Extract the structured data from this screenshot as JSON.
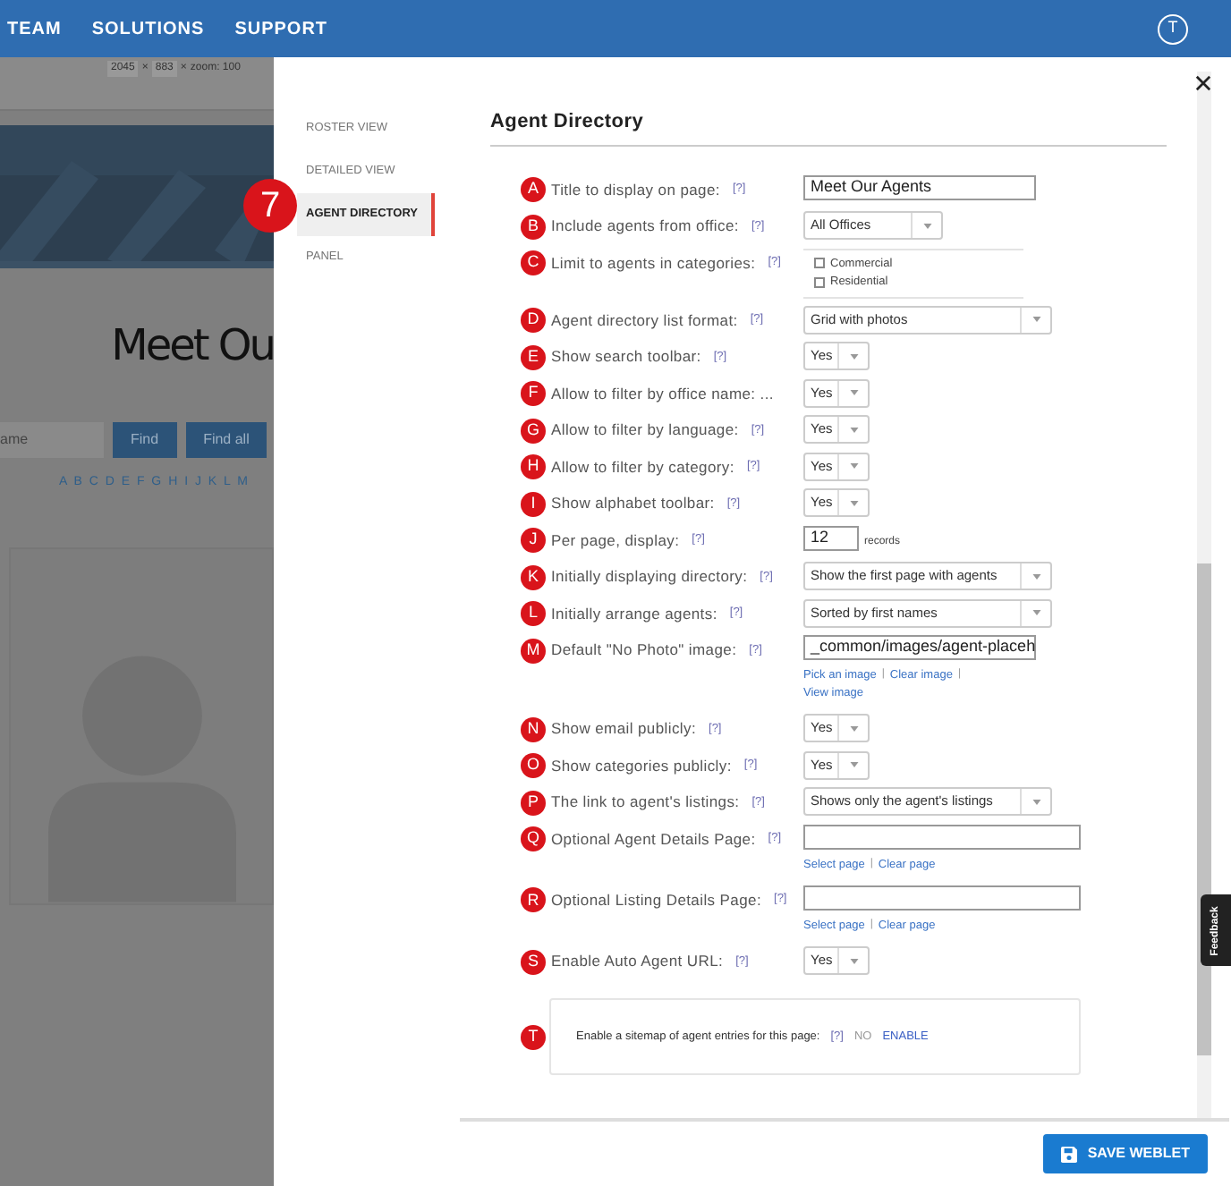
{
  "nav": {
    "items": [
      "TEAM",
      "SOLUTIONS",
      "SUPPORT"
    ],
    "avatar": "T"
  },
  "background": {
    "ruler": [
      "2045",
      "×",
      "883",
      "×",
      "zoom: 100"
    ],
    "heading": "Meet Ou",
    "search_placeholder": "ame",
    "buttons": [
      "Find",
      "Find all"
    ],
    "alphabet": "A B C D E F G H I J K L M"
  },
  "modal": {
    "tabs": [
      {
        "label": "ROSTER VIEW",
        "selected": false
      },
      {
        "label": "DETAILED VIEW",
        "selected": false
      },
      {
        "label": "AGENT DIRECTORY",
        "selected": true
      },
      {
        "label": "PANEL",
        "selected": false
      }
    ],
    "callout": "7",
    "heading": "Agent Directory",
    "separator": "|",
    "rows": [
      {
        "letter": "A",
        "label": "Title to display on page:",
        "help": "[?]",
        "control": {
          "kind": "text",
          "value": "Meet Our Agents"
        }
      },
      {
        "letter": "B",
        "label": "Include agents from office:",
        "help": "[?]",
        "control": {
          "kind": "smallselect",
          "value": "All Offices"
        }
      },
      {
        "letter": "C",
        "label": "Limit to agents in categories:",
        "help": "[?]",
        "control": {
          "kind": "checkboxes",
          "options": [
            {
              "label": "Commercial",
              "checked": false
            },
            {
              "label": "Residential",
              "checked": false
            }
          ]
        }
      },
      {
        "letter": "D",
        "label": "Agent directory list format:",
        "help": "[?]",
        "control": {
          "kind": "select",
          "value": "Grid with photos"
        }
      },
      {
        "letter": "E",
        "label": "Show search toolbar:",
        "help": "[?]",
        "control": {
          "kind": "yesno",
          "value": "Yes"
        }
      },
      {
        "letter": "F",
        "label": "Allow to filter by office name: ...",
        "control": {
          "kind": "yesno",
          "value": "Yes"
        }
      },
      {
        "letter": "G",
        "label": "Allow to filter by language:",
        "help": "[?]",
        "control": {
          "kind": "yesno",
          "value": "Yes"
        }
      },
      {
        "letter": "H",
        "label": "Allow to filter by category:",
        "help": "[?]",
        "control": {
          "kind": "yesno",
          "value": "Yes"
        }
      },
      {
        "letter": "I",
        "label": "Show alphabet toolbar:",
        "help": "[?]",
        "control": {
          "kind": "yesno",
          "value": "Yes"
        }
      },
      {
        "letter": "J",
        "label": "Per page, display:",
        "help": "[?]",
        "control": {
          "kind": "number",
          "value": "12",
          "suffix": "records"
        }
      },
      {
        "letter": "K",
        "label": "Initially displaying directory:",
        "help": "[?]",
        "control": {
          "kind": "select",
          "value": "Show the first page with agents"
        }
      },
      {
        "letter": "L",
        "label": "Initially arrange agents:",
        "help": "[?]",
        "control": {
          "kind": "select",
          "value": "Sorted by first names"
        }
      },
      {
        "letter": "M",
        "label": "Default \"No Photo\" image:",
        "help": "[?]",
        "control": {
          "kind": "text",
          "value": "_common/images/agent-placeh",
          "links": [
            "Pick an image",
            "Clear image",
            "View image"
          ]
        }
      },
      {
        "letter": "N",
        "label": "Show email publicly:",
        "help": "[?]",
        "control": {
          "kind": "yesno",
          "value": "Yes"
        }
      },
      {
        "letter": "O",
        "label": "Show categories publicly:",
        "help": "[?]",
        "control": {
          "kind": "yesno",
          "value": "Yes"
        }
      },
      {
        "letter": "P",
        "label": "The link to agent's listings:",
        "help": "[?]",
        "control": {
          "kind": "select",
          "value": "Shows only the agent's listings"
        }
      },
      {
        "letter": "Q",
        "label": "Optional Agent Details Page:",
        "help": "[?]",
        "control": {
          "kind": "widetext",
          "links": [
            "Select page",
            "Clear page"
          ]
        }
      },
      {
        "letter": "R",
        "label": "Optional Listing Details Page:",
        "help": "[?]",
        "control": {
          "kind": "widetext",
          "links": [
            "Select page",
            "Clear page"
          ]
        }
      },
      {
        "letter": "S",
        "label": "Enable Auto Agent URL:",
        "help": "[?]",
        "control": {
          "kind": "yesno",
          "value": "Yes"
        }
      }
    ],
    "sitemap": {
      "letter": "T",
      "label": "Enable a sitemap of agent entries for this page:",
      "help": "[?]",
      "no": "NO",
      "enable": "ENABLE"
    },
    "save_button": "SAVE WEBLET",
    "feedback": "Feedback"
  }
}
